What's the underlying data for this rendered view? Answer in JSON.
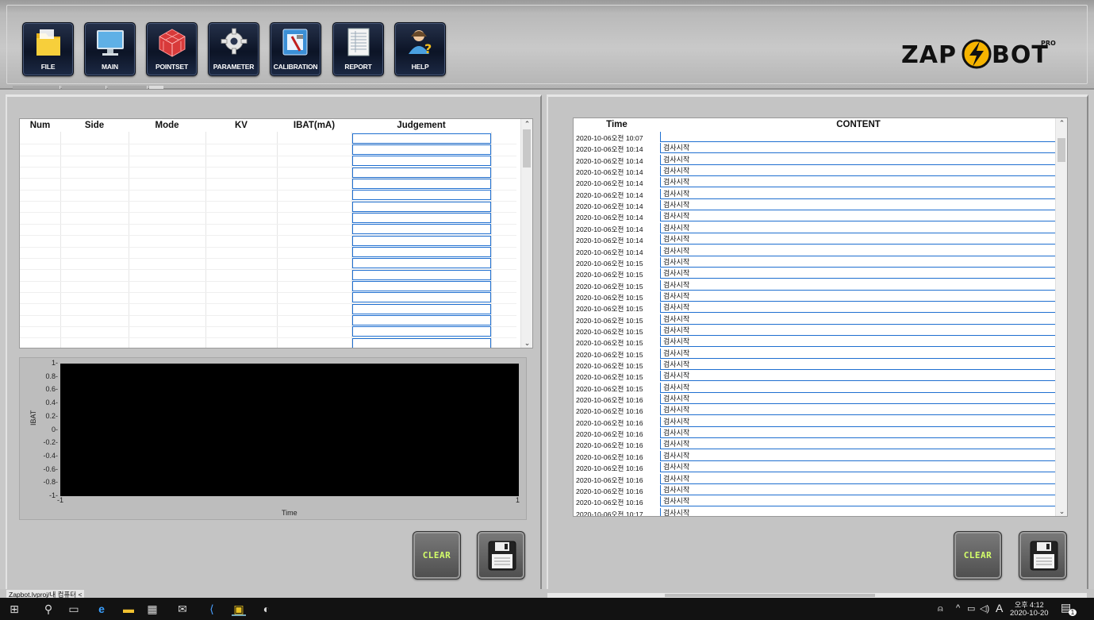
{
  "toolbar": {
    "buttons": [
      {
        "label": "FILE",
        "icon": "folder-icon"
      },
      {
        "label": "MAIN",
        "icon": "monitor-icon"
      },
      {
        "label": "POINTSET",
        "icon": "grid-cube-icon"
      },
      {
        "label": "PARAMETER",
        "icon": "gear-icon"
      },
      {
        "label": "CALIBRATION",
        "icon": "tool-icon"
      },
      {
        "label": "REPORT",
        "icon": "report-icon"
      },
      {
        "label": "HELP",
        "icon": "help-user-icon"
      }
    ],
    "logo": {
      "brand": "ZAP",
      "brand2": "BOT",
      "badge": "PRO"
    }
  },
  "left_table": {
    "columns": [
      "Num",
      "Side",
      "Mode",
      "KV",
      "IBAT(mA)",
      "Judgement"
    ],
    "row_count": 19
  },
  "graph": {
    "ylabel": "IBAT",
    "xlabel": "Time",
    "yticks": [
      "1",
      "0.8",
      "0.6",
      "0.4",
      "0.2",
      "0",
      "-0.2",
      "-0.4",
      "-0.6",
      "-0.8",
      "-1"
    ],
    "xticks": [
      "-1",
      "1"
    ],
    "background": "#000000"
  },
  "buttons": {
    "clear_label": "CLEAR",
    "save_icon": "floppy-disk-icon"
  },
  "right_table": {
    "columns": [
      "Time",
      "CONTENT"
    ],
    "rows": [
      {
        "time": "2020-10-06오전 10:07",
        "content": ""
      },
      {
        "time": "2020-10-06오전 10:14",
        "content": "검사시작"
      },
      {
        "time": "2020-10-06오전 10:14",
        "content": "검사시작"
      },
      {
        "time": "2020-10-06오전 10:14",
        "content": "검사시작"
      },
      {
        "time": "2020-10-06오전 10:14",
        "content": "검사시작"
      },
      {
        "time": "2020-10-06오전 10:14",
        "content": "검사시작"
      },
      {
        "time": "2020-10-06오전 10:14",
        "content": "검사시작"
      },
      {
        "time": "2020-10-06오전 10:14",
        "content": "검사시작"
      },
      {
        "time": "2020-10-06오전 10:14",
        "content": "검사시작"
      },
      {
        "time": "2020-10-06오전 10:14",
        "content": "검사시작"
      },
      {
        "time": "2020-10-06오전 10:14",
        "content": "검사시작"
      },
      {
        "time": "2020-10-06오전 10:15",
        "content": "검사시작"
      },
      {
        "time": "2020-10-06오전 10:15",
        "content": "검사시작"
      },
      {
        "time": "2020-10-06오전 10:15",
        "content": "검사시작"
      },
      {
        "time": "2020-10-06오전 10:15",
        "content": "검사시작"
      },
      {
        "time": "2020-10-06오전 10:15",
        "content": "검사시작"
      },
      {
        "time": "2020-10-06오전 10:15",
        "content": "검사시작"
      },
      {
        "time": "2020-10-06오전 10:15",
        "content": "검사시작"
      },
      {
        "time": "2020-10-06오전 10:15",
        "content": "검사시작"
      },
      {
        "time": "2020-10-06오전 10:15",
        "content": "검사시작"
      },
      {
        "time": "2020-10-06오전 10:15",
        "content": "검사시작"
      },
      {
        "time": "2020-10-06오전 10:15",
        "content": "검사시작"
      },
      {
        "time": "2020-10-06오전 10:15",
        "content": "검사시작"
      },
      {
        "time": "2020-10-06오전 10:16",
        "content": "검사시작"
      },
      {
        "time": "2020-10-06오전 10:16",
        "content": "검사시작"
      },
      {
        "time": "2020-10-06오전 10:16",
        "content": "검사시작"
      },
      {
        "time": "2020-10-06오전 10:16",
        "content": "검사시작"
      },
      {
        "time": "2020-10-06오전 10:16",
        "content": "검사시작"
      },
      {
        "time": "2020-10-06오전 10:16",
        "content": "검사시작"
      },
      {
        "time": "2020-10-06오전 10:16",
        "content": "검사시작"
      },
      {
        "time": "2020-10-06오전 10:16",
        "content": "검사시작"
      },
      {
        "time": "2020-10-06오전 10:16",
        "content": "검사시작"
      },
      {
        "time": "2020-10-06오전 10:16",
        "content": "검사시작"
      },
      {
        "time": "2020-10-06오전 10:17",
        "content": "검사시작"
      },
      {
        "time": "2020-10-06오전 10:17",
        "content": "검사시작"
      }
    ]
  },
  "status_bar": {
    "text": "Zapbot.lvproj/내 컴퓨터 <"
  },
  "taskbar": {
    "icons": [
      "windows-start-icon",
      "search-icon",
      "task-view-icon",
      "edge-icon",
      "file-explorer-icon",
      "store-icon",
      "mail-icon",
      "app-icon",
      "labview-icon",
      "paint-icon"
    ],
    "tray": {
      "ampm": "오후 4:12",
      "date": "2020-10-20",
      "lang": "A",
      "notification_count": "1"
    }
  }
}
